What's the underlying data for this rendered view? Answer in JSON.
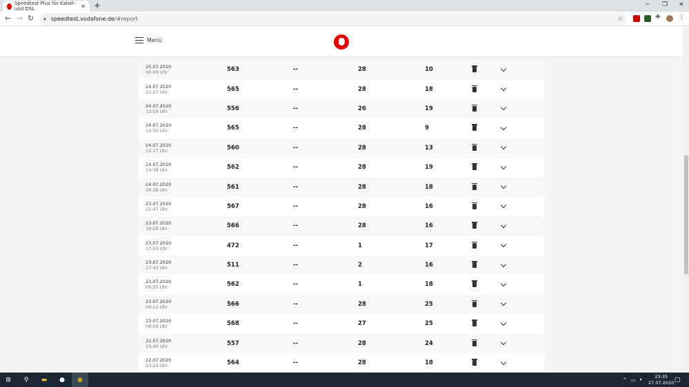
{
  "browser": {
    "tab_title": "Speedtest Plus für Kabel- und DSL",
    "url_host": "speedtest.vodafone.de",
    "url_path": "/#report",
    "new_tab": "+",
    "close": "✕"
  },
  "header": {
    "menu_label": "Menü"
  },
  "colors": {
    "brand": "#e60000",
    "taskbar": "#1c2733"
  },
  "rows": [
    {
      "date": "25.07.2020",
      "time": "00:09 Uhr",
      "download": "563",
      "ping": "--",
      "upload": "28",
      "jitter": "10"
    },
    {
      "date": "24.07.2020",
      "time": "21:27 Uhr",
      "download": "565",
      "ping": "--",
      "upload": "28",
      "jitter": "18"
    },
    {
      "date": "24.07.2020",
      "time": "13:59 Uhr",
      "download": "556",
      "ping": "--",
      "upload": "26",
      "jitter": "19"
    },
    {
      "date": "24.07.2020",
      "time": "12:30 Uhr",
      "download": "565",
      "ping": "--",
      "upload": "28",
      "jitter": "9"
    },
    {
      "date": "24.07.2020",
      "time": "12:17 Uhr",
      "download": "560",
      "ping": "--",
      "upload": "28",
      "jitter": "13"
    },
    {
      "date": "24.07.2020",
      "time": "10:38 Uhr",
      "download": "562",
      "ping": "--",
      "upload": "28",
      "jitter": "19"
    },
    {
      "date": "24.07.2020",
      "time": "08:38 Uhr",
      "download": "561",
      "ping": "--",
      "upload": "28",
      "jitter": "18"
    },
    {
      "date": "23.07.2020",
      "time": "22:47 Uhr",
      "download": "567",
      "ping": "--",
      "upload": "28",
      "jitter": "16"
    },
    {
      "date": "23.07.2020",
      "time": "19:29 Uhr",
      "download": "566",
      "ping": "--",
      "upload": "28",
      "jitter": "16"
    },
    {
      "date": "23.07.2020",
      "time": "17:59 Uhr",
      "download": "472",
      "ping": "--",
      "upload": "1",
      "jitter": "17"
    },
    {
      "date": "23.07.2020",
      "time": "17:43 Uhr",
      "download": "511",
      "ping": "--",
      "upload": "2",
      "jitter": "16"
    },
    {
      "date": "23.07.2020",
      "time": "09:55 Uhr",
      "download": "562",
      "ping": "--",
      "upload": "1",
      "jitter": "18"
    },
    {
      "date": "23.07.2020",
      "time": "09:12 Uhr",
      "download": "566",
      "ping": "--",
      "upload": "28",
      "jitter": "25"
    },
    {
      "date": "23.07.2020",
      "time": "08:06 Uhr",
      "download": "568",
      "ping": "--",
      "upload": "27",
      "jitter": "25"
    },
    {
      "date": "22.07.2020",
      "time": "23:40 Uhr",
      "download": "557",
      "ping": "--",
      "upload": "28",
      "jitter": "24"
    },
    {
      "date": "22.07.2020",
      "time": "23:24 Uhr",
      "download": "564",
      "ping": "--",
      "upload": "28",
      "jitter": "18"
    }
  ],
  "taskbar": {
    "time": "23:35",
    "date": "27.07.2020"
  }
}
